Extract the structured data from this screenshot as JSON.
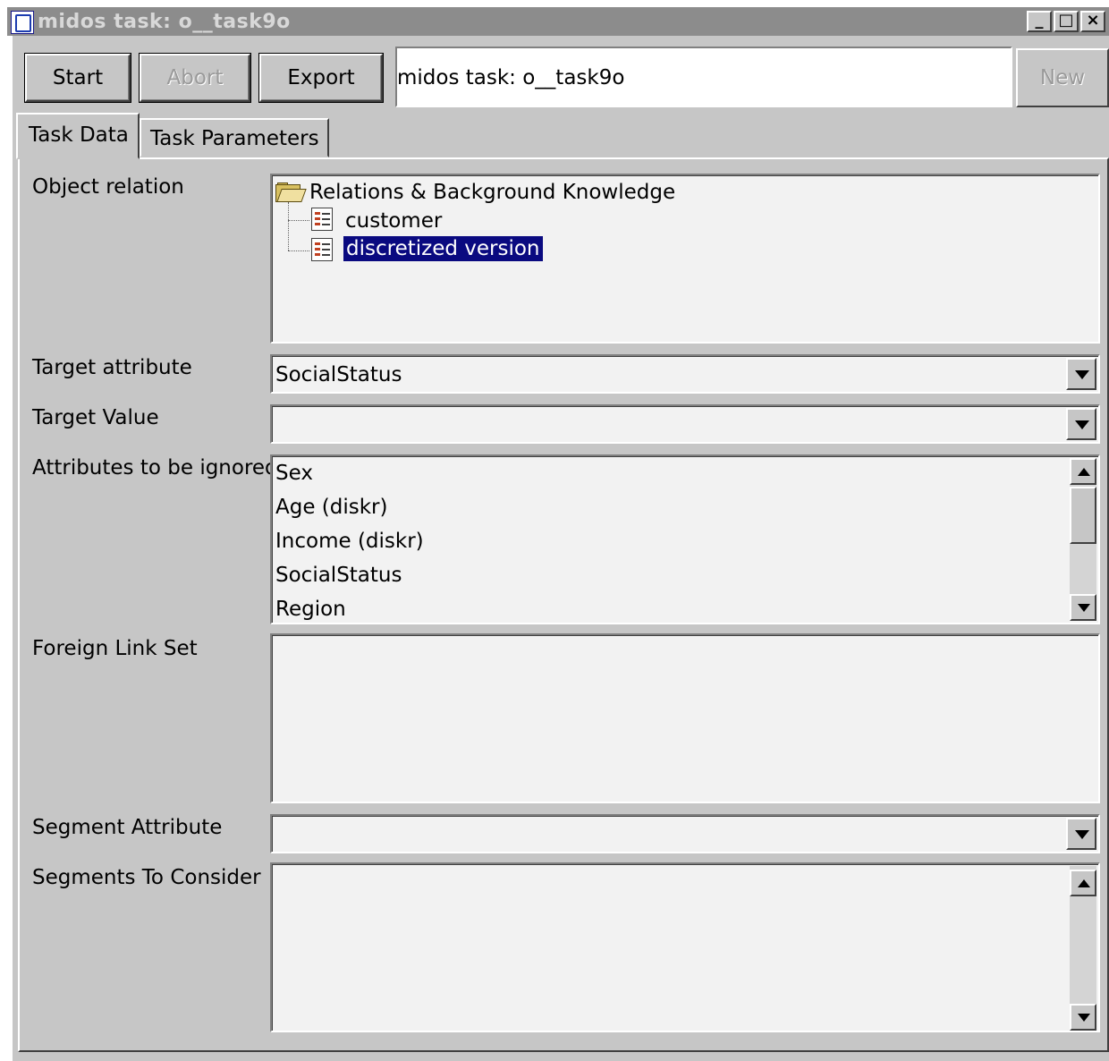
{
  "window": {
    "title": "midos task: o__task9o",
    "controls": {
      "minimize": "_",
      "maximize": "□",
      "close": "×"
    }
  },
  "toolbar": {
    "start_label": "Start",
    "abort_label": "Abort",
    "export_label": "Export",
    "task_name": "midos task: o__task9o",
    "new_label": "New"
  },
  "tabs": [
    {
      "label": "Task Data",
      "active": true
    },
    {
      "label": "Task Parameters",
      "active": false
    }
  ],
  "form": {
    "object_relation_label": "Object relation",
    "tree": {
      "root": "Relations & Background Knowledge",
      "children": [
        "customer",
        "discretized version"
      ],
      "selected": "discretized version"
    },
    "target_attribute_label": "Target attribute",
    "target_attribute_value": "SocialStatus",
    "target_value_label": "Target Value",
    "target_value_value": "",
    "ignored_label": "Attributes to be ignored",
    "ignored_items": [
      "Sex",
      "Age (diskr)",
      "Income (diskr)",
      "SocialStatus",
      "Region"
    ],
    "foreign_link_label": "Foreign Link Set",
    "segment_attribute_label": "Segment Attribute",
    "segment_attribute_value": "",
    "segments_label": "Segments To Consider"
  },
  "colors": {
    "selection": "#0a0a80",
    "face": "#c6c6c6",
    "titlebar": "#8c8c8c"
  }
}
